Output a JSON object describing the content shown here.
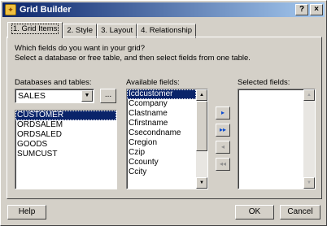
{
  "window": {
    "title": "Grid Builder",
    "help_glyph": "?",
    "close_glyph": "×"
  },
  "tabs": [
    {
      "label": "1. Grid Items"
    },
    {
      "label": "2. Style"
    },
    {
      "label": "3. Layout"
    },
    {
      "label": "4. Relationship"
    }
  ],
  "instructions": {
    "line1": "Which fields do you want in your grid?",
    "line2": "Select a database or free table, and then select fields from one table."
  },
  "databases": {
    "label": "Databases and tables:",
    "selected_db": "SALES",
    "browse_label": "...",
    "tables": [
      "CUSTOMER",
      "ORDSALEM",
      "ORDSALED",
      "GOODS",
      "SUMCUST"
    ],
    "selected_index": 0
  },
  "available_fields": {
    "label": "Available fields:",
    "items": [
      "Icdcustomer",
      "Ccompany",
      "Clastname",
      "Cfirstname",
      "Csecondname",
      "Cregion",
      "Czip",
      "Ccounty",
      "Ccity"
    ],
    "selected_index": 0
  },
  "selected_fields": {
    "label": "Selected fields:",
    "items": []
  },
  "move_buttons": {
    "add_one": "▸",
    "add_all": "▸▸",
    "remove_one": "◂",
    "remove_all": "◂◂"
  },
  "footer": {
    "help_label": "Help",
    "ok_label": "OK",
    "cancel_label": "Cancel"
  }
}
